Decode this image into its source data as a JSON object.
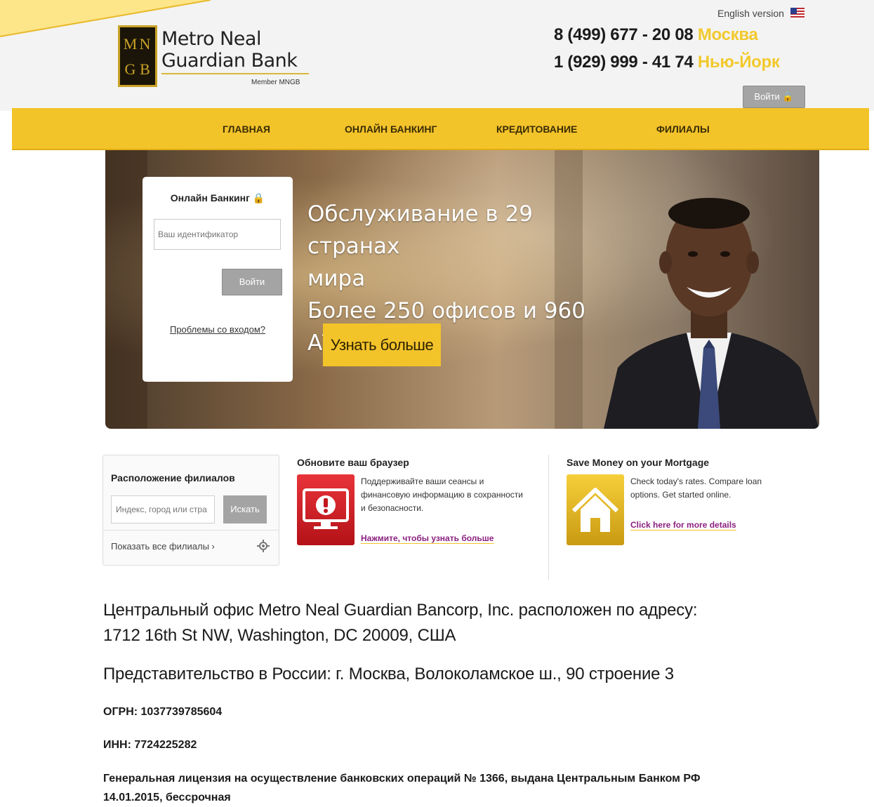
{
  "header": {
    "logo": {
      "letters": [
        "M",
        "N",
        "G",
        "B"
      ],
      "name_line1": "Metro Neal",
      "name_line2": "Guardian Bank",
      "member": "Member MNGB"
    },
    "english_version": "English version",
    "phones": [
      {
        "number": "8 (499) 677 - 20 08",
        "city": "Москва"
      },
      {
        "number": "1 (929) 999 - 41 74",
        "city": "Нью-Йорк"
      }
    ],
    "login_button": "Войти 🔒"
  },
  "nav": {
    "items": [
      "ГЛАВНАЯ",
      "ОНЛАЙН БАНКИНГ",
      "КРЕДИТОВАНИЕ",
      "ФИЛИАЛЫ"
    ]
  },
  "hero": {
    "login_card": {
      "title": "Онлайн Банкинг 🔒",
      "id_placeholder": "Ваш идентификатор",
      "submit": "Войти",
      "problem_link": "Проблемы со входом?"
    },
    "headline_line1": "Обслуживание в 29 странах",
    "headline_line2": "мира",
    "headline_line3": "Более 250 офисов и 960 АТМ",
    "cta": "Узнать больше"
  },
  "branches": {
    "title": "Расположение филиалов",
    "placeholder": "Индекс, город или стра",
    "search_button": "Искать",
    "show_all": "Показать все филиалы ›"
  },
  "browser_widget": {
    "title": "Обновите ваш браузер",
    "desc_line1": "Поддерживайте ваши сеансы и",
    "desc_line2": "финансовую информацию в сохранности",
    "desc_line3": "и безопасности.",
    "link": "Нажмите, чтобы узнать больше"
  },
  "mortgage_widget": {
    "title": "Save Money on your Mortgage",
    "desc_line1": "Check today's rates. Compare loan",
    "desc_line2": "options. Get started online.",
    "link": "Click here for more details"
  },
  "footer": {
    "address_line1": "Центральный офис Metro Neal Guardian Bancorp, Inc. расположен по адресу:",
    "address_line2": "1712 16th St NW, Washington, DC 20009, США",
    "representative": "Представительство в России: г. Москва, Волоколамское ш., 90 строение 3",
    "ogrn": "ОГРН: 1037739785604",
    "inn": "ИНН: 7724225282",
    "license_line1": "Генеральная лицензия на осуществление банковских операций № 1366, выдана Центральным Банком РФ",
    "license_line2": "14.01.2015, бессрочная"
  },
  "colors": {
    "accent": "#f3c32a",
    "link": "#8b1f7f",
    "button_gray": "#a4a4a4",
    "alert_red": "#d3252b"
  }
}
